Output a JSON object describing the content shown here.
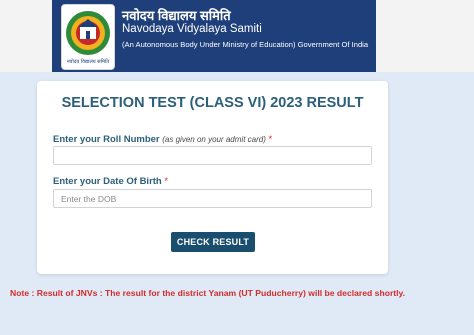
{
  "header": {
    "org_name_hindi": "नवोदय विद्यालय समिति",
    "org_name": "Navodaya Vidyalaya Samiti",
    "org_subtitle": "(An Autonomous Body Under Ministry of Education) Government Of India",
    "logo_text": "नवोदय विद्यालय समिति",
    "logo_icon": "nvs-logo-icon"
  },
  "card": {
    "title": "SELECTION TEST (CLASS VI) 2023 RESULT",
    "roll_number": {
      "label": "Enter your Roll Number",
      "hint": "(as given on your admit card)",
      "required_mark": "*",
      "value": "",
      "placeholder": ""
    },
    "dob": {
      "label": "Enter your Date Of Birth",
      "required_mark": "*",
      "value": "",
      "placeholder": "Enter the DOB"
    },
    "submit_label": "CHECK RESULT"
  },
  "note": "Note : Result of JNVs : The result for the district Yanam (UT Puducherry) will be declared shortly.",
  "colors": {
    "header_band": "#1f3f7a",
    "title": "#2c5f7a",
    "button": "#1a4e6e",
    "required": "#d62b2b",
    "note": "#d62b2b",
    "page_background": "#dfeaf6"
  }
}
